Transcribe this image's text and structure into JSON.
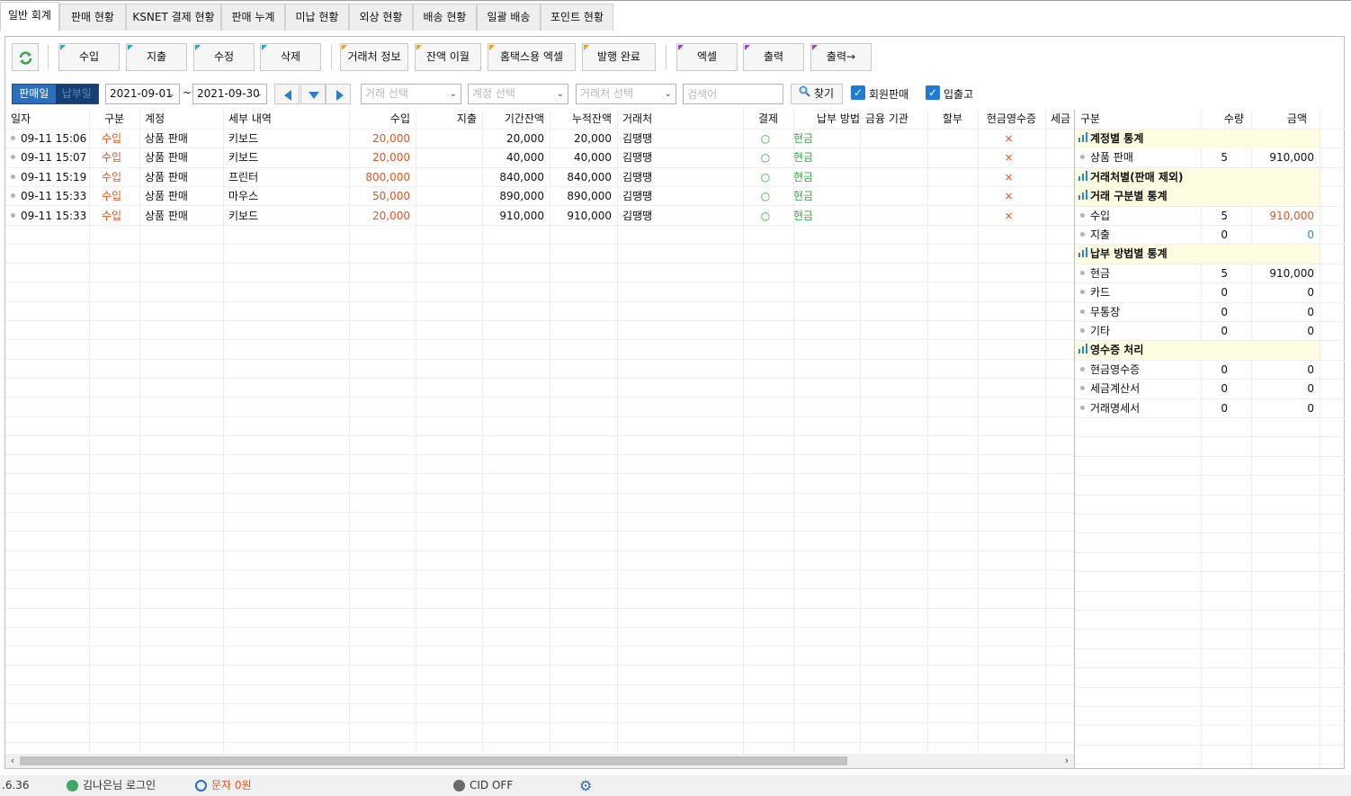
{
  "tabs": [
    "일반 회계",
    "판매 현황",
    "KSNET 결제 현황",
    "판매 누계",
    "미납 현황",
    "외상 현황",
    "배송 현황",
    "일괄 배송",
    "포인트 현황"
  ],
  "toolbar": {
    "refresh_icon": "refresh-icon",
    "buttons": [
      "수입",
      "지출",
      "수정",
      "삭제",
      "거래처 정보",
      "잔액 이월",
      "홈택스용 엑셀",
      "발행 완료",
      "엑셀",
      "출력",
      "출력→"
    ]
  },
  "filters": {
    "date_mode": [
      "판매일",
      "납부일"
    ],
    "date_from": "2021-09-01",
    "date_sep": "~",
    "date_to": "2021-09-30",
    "partner_placeholder": "거래 선택",
    "account_placeholder": "계정 선택",
    "vendor_placeholder": "거래처 선택",
    "search_placeholder": "검색어",
    "find_label": "찾기",
    "member_sales_label": "회원판매",
    "inout_label": "입출고"
  },
  "table": {
    "columns": [
      "일자",
      "구분",
      "계정",
      "세부 내역",
      "수입",
      "지출",
      "기간잔액",
      "누적잔액",
      "거래처",
      "결제",
      "납부 방법",
      "금융 기관",
      "할부",
      "현금영수증",
      "세금"
    ],
    "rows": [
      {
        "date": "09-11 15:06",
        "type": "수입",
        "account": "상품 판매",
        "detail": "키보드",
        "income": "20,000",
        "expense": "",
        "period_balance": "20,000",
        "cum_balance": "20,000",
        "vendor": "김땡땡",
        "paid": "○",
        "method": "현금",
        "bank": "",
        "installment": "",
        "cash_receipt": "×",
        "tax": ""
      },
      {
        "date": "09-11 15:07",
        "type": "수입",
        "account": "상품 판매",
        "detail": "키보드",
        "income": "20,000",
        "expense": "",
        "period_balance": "40,000",
        "cum_balance": "40,000",
        "vendor": "김땡땡",
        "paid": "○",
        "method": "현금",
        "bank": "",
        "installment": "",
        "cash_receipt": "×",
        "tax": ""
      },
      {
        "date": "09-11 15:19",
        "type": "수입",
        "account": "상품 판매",
        "detail": "프린터",
        "income": "800,000",
        "expense": "",
        "period_balance": "840,000",
        "cum_balance": "840,000",
        "vendor": "김땡땡",
        "paid": "○",
        "method": "현금",
        "bank": "",
        "installment": "",
        "cash_receipt": "×",
        "tax": ""
      },
      {
        "date": "09-11 15:33",
        "type": "수입",
        "account": "상품 판매",
        "detail": "마우스",
        "income": "50,000",
        "expense": "",
        "period_balance": "890,000",
        "cum_balance": "890,000",
        "vendor": "김땡땡",
        "paid": "○",
        "method": "현금",
        "bank": "",
        "installment": "",
        "cash_receipt": "×",
        "tax": ""
      },
      {
        "date": "09-11 15:33",
        "type": "수입",
        "account": "상품 판매",
        "detail": "키보드",
        "income": "20,000",
        "expense": "",
        "period_balance": "910,000",
        "cum_balance": "910,000",
        "vendor": "김땡땡",
        "paid": "○",
        "method": "현금",
        "bank": "",
        "installment": "",
        "cash_receipt": "×",
        "tax": ""
      }
    ]
  },
  "stats": {
    "columns": [
      "구분",
      "수량",
      "금액"
    ],
    "rows": [
      {
        "kind": "section",
        "label": "계정별 통계"
      },
      {
        "kind": "item",
        "label": "상품 판매",
        "qty": "5",
        "amount": "910,000",
        "amount_color": "default"
      },
      {
        "kind": "section",
        "label": "거래처별(판매 제외)"
      },
      {
        "kind": "section",
        "label": "거래 구분별 통계"
      },
      {
        "kind": "item",
        "label": "수입",
        "qty": "5",
        "amount": "910,000",
        "amount_color": "red"
      },
      {
        "kind": "item",
        "label": "지출",
        "qty": "0",
        "amount": "0",
        "amount_color": "blue"
      },
      {
        "kind": "section",
        "label": "납부 방법별 통계"
      },
      {
        "kind": "item",
        "label": "현금",
        "qty": "5",
        "amount": "910,000",
        "amount_color": "default"
      },
      {
        "kind": "item",
        "label": "카드",
        "qty": "0",
        "amount": "0",
        "amount_color": "default"
      },
      {
        "kind": "item",
        "label": "무통장",
        "qty": "0",
        "amount": "0",
        "amount_color": "default"
      },
      {
        "kind": "item",
        "label": "기타",
        "qty": "0",
        "amount": "0",
        "amount_color": "default"
      },
      {
        "kind": "section",
        "label": "영수증 처리"
      },
      {
        "kind": "item",
        "label": "현금영수증",
        "qty": "0",
        "amount": "0",
        "amount_color": "default"
      },
      {
        "kind": "item",
        "label": "세금계산서",
        "qty": "0",
        "amount": "0",
        "amount_color": "default"
      },
      {
        "kind": "item",
        "label": "거래명세서",
        "qty": "0",
        "amount": "0",
        "amount_color": "default"
      }
    ]
  },
  "statusbar": {
    "version": ".6.36",
    "user": "김나은님 로그인",
    "sms": "문자 0원",
    "cid": "CID OFF"
  },
  "colors": {
    "income": "#e5531d",
    "paid": "#2cab3b",
    "expense_amount": "#2b86d8",
    "section_bg": "#fdfbe0",
    "accent": "#1f7bd6"
  }
}
